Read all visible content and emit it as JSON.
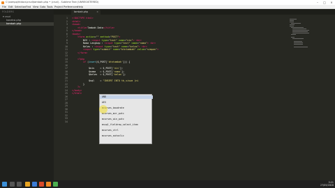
{
  "window": {
    "title": "C:\\xampp\\htdocs\\crud\\tambah.php • (crud) - Sublime Text (UNREGISTERED)"
  },
  "menu": [
    "File",
    "Edit",
    "Selection",
    "Find",
    "View",
    "Goto",
    "Tools",
    "Project",
    "Preferences",
    "Help"
  ],
  "sidebar": {
    "header": "FOLDERS",
    "items": [
      {
        "label": "▾ crud",
        "selected": false
      },
      {
        "label": "koneksi.php",
        "selected": false
      },
      {
        "label": "tambah.php",
        "selected": true
      }
    ]
  },
  "tab": {
    "label": "tambah.php",
    "close": "×"
  },
  "autocomplete": {
    "items": [
      "AND",
      "AES",
      "mcurses_baudrate",
      "mcurses_mvr_putc",
      "mcurses_win_putc",
      "mssql_fieldrow_select_item",
      "mcurses_ctrl",
      "mcurses_autoclic"
    ]
  },
  "taskbar": {
    "time": "5:21",
    "date": "27/05/2018"
  }
}
